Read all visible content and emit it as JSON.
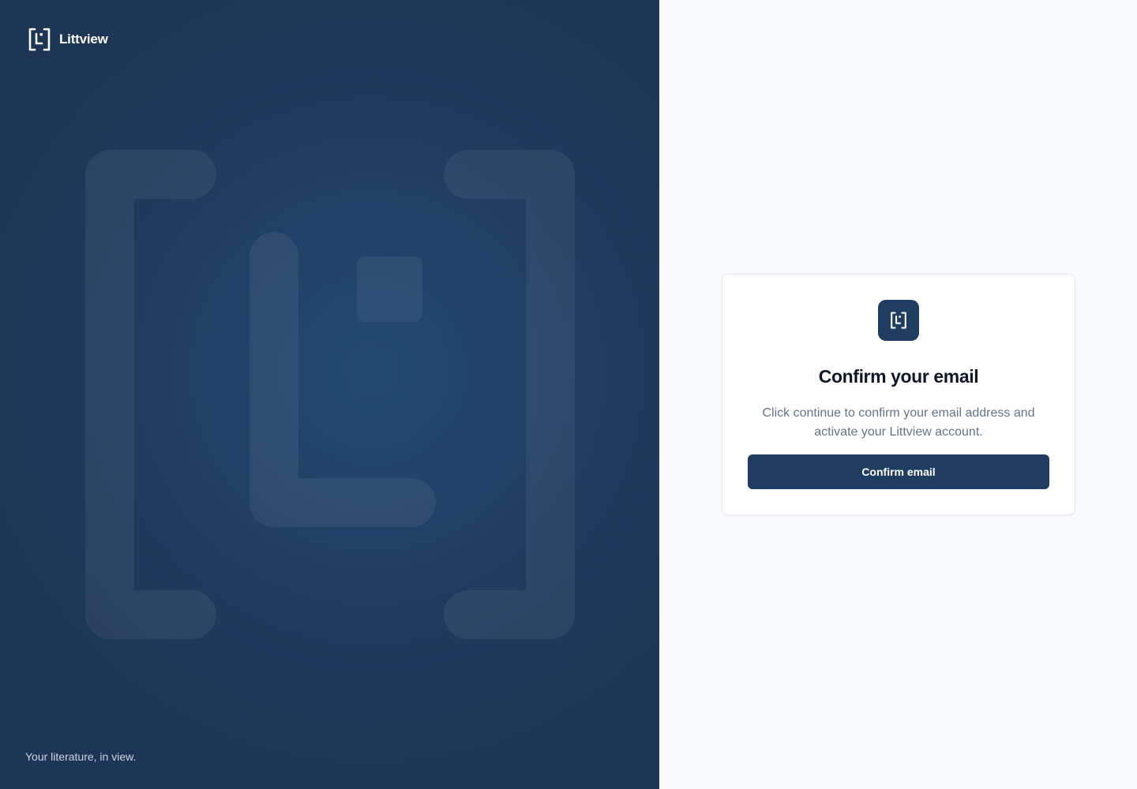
{
  "brand": {
    "name": "Littview",
    "logo_icon": "littview-bracket-logo-icon",
    "tagline": "Your literature, in view."
  },
  "card": {
    "logo_icon": "littview-bracket-logo-icon",
    "title": "Confirm your email",
    "description": "Click continue to confirm your email address and activate your Littview account.",
    "button_label": "Confirm email"
  },
  "colors": {
    "brand_navy": "#1f3d60",
    "panel_background": "#f8fafc",
    "title_text": "#0f172a",
    "muted_text": "#64748b"
  }
}
